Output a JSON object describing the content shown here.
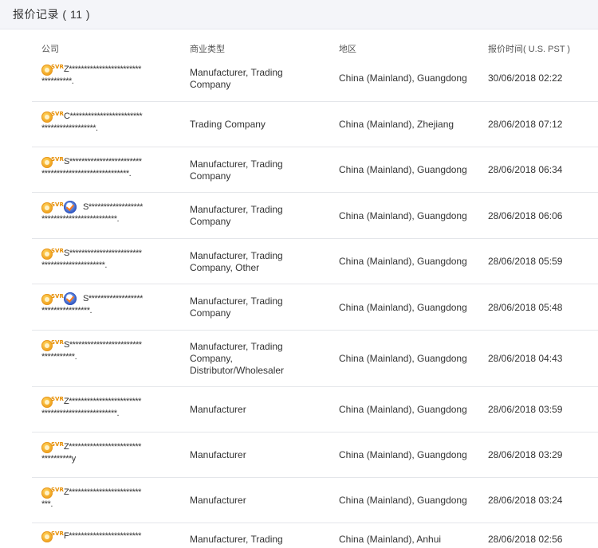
{
  "header": {
    "title": "报价记录 ( 11 )"
  },
  "columns": {
    "company": "公司",
    "business_type": "商业类型",
    "region": "地区",
    "time": "报价时间( U.S. PST )"
  },
  "rows": [
    {
      "company_line1": "Z************************",
      "company_line2": "**********.",
      "verified": false,
      "business_type": [
        "Manufacturer, Trading",
        "Company"
      ],
      "region": "China (Mainland), Guangdong",
      "time": "30/06/2018 02:22"
    },
    {
      "company_line1": "C************************",
      "company_line2": "******************.",
      "verified": false,
      "business_type": [
        "Trading Company"
      ],
      "region": "China (Mainland), Zhejiang",
      "time": "28/06/2018 07:12"
    },
    {
      "company_line1": "S************************",
      "company_line2": "*****************************.",
      "verified": false,
      "business_type": [
        "Manufacturer, Trading",
        "Company"
      ],
      "region": "China (Mainland), Guangdong",
      "time": "28/06/2018 06:34"
    },
    {
      "company_line1": "S******************",
      "company_line2": "*************************.",
      "verified": true,
      "business_type": [
        "Manufacturer, Trading",
        "Company"
      ],
      "region": "China (Mainland), Guangdong",
      "time": "28/06/2018 06:06"
    },
    {
      "company_line1": "S************************",
      "company_line2": "*********************.",
      "verified": false,
      "business_type": [
        "Manufacturer, Trading",
        "Company, Other"
      ],
      "region": "China (Mainland), Guangdong",
      "time": "28/06/2018 05:59"
    },
    {
      "company_line1": "S******************",
      "company_line2": "****************.",
      "verified": true,
      "business_type": [
        "Manufacturer, Trading",
        "Company"
      ],
      "region": "China (Mainland), Guangdong",
      "time": "28/06/2018 05:48"
    },
    {
      "company_line1": "S************************",
      "company_line2": "***********.",
      "verified": false,
      "business_type": [
        "Manufacturer, Trading",
        "Company,",
        "Distributor/Wholesaler"
      ],
      "region": "China (Mainland), Guangdong",
      "time": "28/06/2018 04:43"
    },
    {
      "company_line1": "Z************************",
      "company_line2": "*************************.",
      "verified": false,
      "business_type": [
        "Manufacturer"
      ],
      "region": "China (Mainland), Guangdong",
      "time": "28/06/2018 03:59"
    },
    {
      "company_line1": "Z************************",
      "company_line2": "**********y",
      "verified": false,
      "business_type": [
        "Manufacturer"
      ],
      "region": "China (Mainland), Guangdong",
      "time": "28/06/2018 03:29"
    },
    {
      "company_line1": "Z************************",
      "company_line2": "***.",
      "verified": false,
      "business_type": [
        "Manufacturer"
      ],
      "region": "China (Mainland), Guangdong",
      "time": "28/06/2018 03:24"
    },
    {
      "company_line1": "F************************",
      "company_line2": "",
      "verified": false,
      "business_type": [
        "Manufacturer, Trading"
      ],
      "region": "China (Mainland), Anhui",
      "time": "28/06/2018 02:56"
    }
  ],
  "badge": {
    "svr_label": "SVR"
  }
}
